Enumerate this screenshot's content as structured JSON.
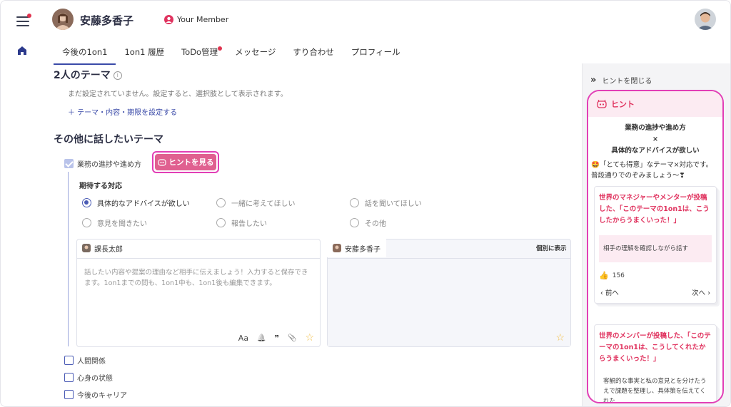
{
  "header": {
    "user_name": "安藤多香子",
    "member_label": "Your Member"
  },
  "tabs": [
    {
      "label": "今後の1on1",
      "active": true,
      "badge": false
    },
    {
      "label": "1on1 履歴",
      "active": false,
      "badge": false
    },
    {
      "label": "ToDo管理",
      "active": false,
      "badge": true
    },
    {
      "label": "メッセージ",
      "active": false,
      "badge": false
    },
    {
      "label": "すり合わせ",
      "active": false,
      "badge": false
    },
    {
      "label": "プロフィール",
      "active": false,
      "badge": false
    }
  ],
  "theme_section": {
    "title": "2人のテーマ",
    "info_icon": "i",
    "note": "まだ設定されていません。設定すると、選択肢として表示されます。",
    "add_link": "＋ テーマ・内容・期限を設定する"
  },
  "other_section": {
    "title": "その他に話したいテーマ",
    "topics": [
      {
        "label": "業務の進捗や進め方",
        "checked": true
      },
      {
        "label": "人間関係",
        "checked": false
      },
      {
        "label": "心身の状態",
        "checked": false
      },
      {
        "label": "今後のキャリア",
        "checked": false
      }
    ],
    "hint_button": "ヒントを見る",
    "expect_label": "期待する対応",
    "options": [
      {
        "label": "具体的なアドバイスが欲しい",
        "selected": true
      },
      {
        "label": "一緒に考えてほしい",
        "selected": false
      },
      {
        "label": "話を聞いてほしい",
        "selected": false
      },
      {
        "label": "意見を聞きたい",
        "selected": false
      },
      {
        "label": "報告したい",
        "selected": false
      },
      {
        "label": "その他",
        "selected": false
      }
    ],
    "boss_card": {
      "name": "課長太郎",
      "placeholder": "話したい内容や提案の理由など相手に伝えましょう！入力すると保存できます。1on1までの間も、1on1中も、1on1後も編集できます。",
      "toolbar": {
        "font": "Aa",
        "bell": "🔔",
        "quote": "❞",
        "clip": "📎",
        "star": "☆"
      }
    },
    "member_card": {
      "name": "安藤多香子",
      "separate_label": "個別に表示",
      "star": "☆"
    }
  },
  "hint_panel": {
    "close_label": "ヒントを閉じる",
    "close_icon": "»",
    "title": "ヒント",
    "topic_line1": "業務の進捗や進め方",
    "topic_line2": "×",
    "topic_line3": "具体的なアドバイスが欲しい",
    "message": "「とても得意」なテーマ×対応です。普段通りでのぞみましょう〜❣",
    "message_emoji": "🤩",
    "posts": [
      {
        "title": "世界のマネジャーやメンターが投稿した、「このテーマの1on1は、こうしたからうまくいった！」",
        "quote": "相手の理解を確認しながら話す",
        "likes": "156",
        "prev": "前へ",
        "next": "次へ"
      },
      {
        "title": "世界のメンバーが投稿した、「このテーマの1on1は、こうしてくれたからうまくいった！」",
        "quote": "客観的な事実と私の意見とを分けたうえで課題を整理し、具体策を伝えてくれた"
      }
    ]
  },
  "colors": {
    "accent": "#3a4aa8",
    "pink": "#e0335f",
    "hint_button": "#e06090",
    "highlight_border": "#e23fb6"
  }
}
